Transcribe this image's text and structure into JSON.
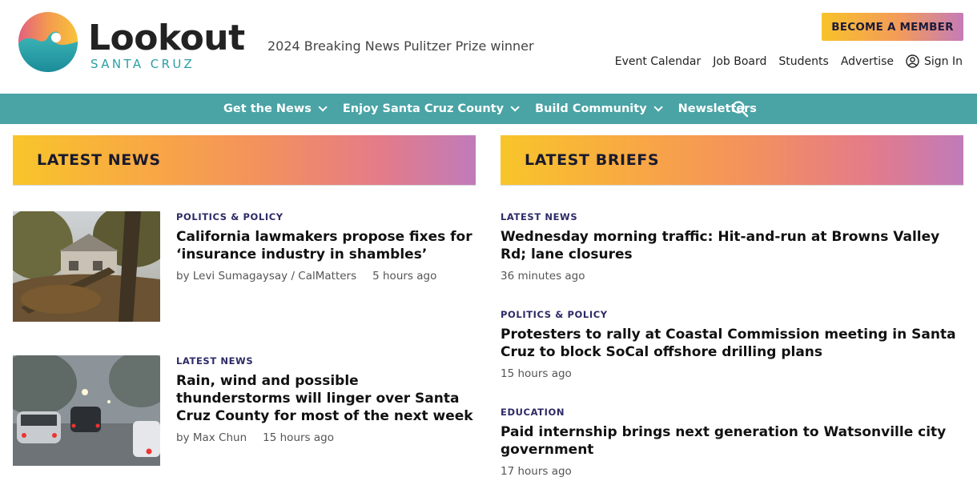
{
  "header": {
    "brand_name": "Lookout",
    "brand_sub": "SANTA CRUZ",
    "tagline": "2024 Breaking News Pulitzer Prize winner",
    "member_button": "BECOME A MEMBER",
    "links": [
      "Event Calendar",
      "Job Board",
      "Students",
      "Advertise"
    ],
    "sign_in": "Sign In"
  },
  "nav": {
    "items": [
      {
        "label": "Get the News",
        "has_dropdown": true
      },
      {
        "label": "Enjoy Santa Cruz County",
        "has_dropdown": true
      },
      {
        "label": "Build Community",
        "has_dropdown": true
      },
      {
        "label": "Newsletters",
        "has_dropdown": false
      }
    ],
    "search_icon": "search-icon"
  },
  "latest_news": {
    "title": "LATEST NEWS",
    "stories": [
      {
        "category": "POLITICS & POLICY",
        "headline": "California lawmakers propose fixes for ‘insurance industry in shambles’",
        "byline": "by Levi Sumagaysay / CalMatters",
        "time": "5 hours ago"
      },
      {
        "category": "LATEST NEWS",
        "headline": "Rain, wind and possible thunderstorms will linger over Santa Cruz County for most of the next week",
        "byline": "by Max Chun",
        "time": "15 hours ago"
      }
    ]
  },
  "latest_briefs": {
    "title": "LATEST BRIEFS",
    "briefs": [
      {
        "category": "LATEST NEWS",
        "headline": "Wednesday morning traffic: Hit-and-run at Browns Valley Rd; lane closures",
        "time": "36 minutes ago"
      },
      {
        "category": "POLITICS & POLICY",
        "headline": "Protesters to rally at Coastal Commission meeting in Santa Cruz to block SoCal offshore drilling plans",
        "time": "15 hours ago"
      },
      {
        "category": "EDUCATION",
        "headline": "Paid internship brings next generation to Watsonville city government",
        "time": "17 hours ago"
      }
    ]
  },
  "colors": {
    "nav_bg": "#4aa3a5",
    "category_text": "#2d2a66",
    "brand_teal": "#2a9fa3"
  }
}
